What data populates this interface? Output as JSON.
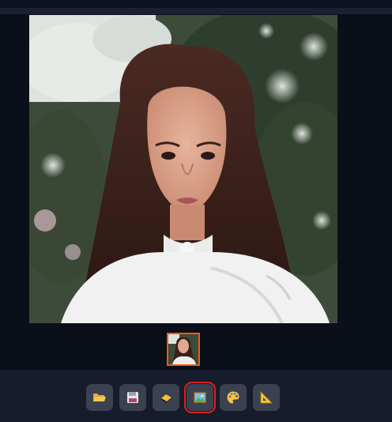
{
  "viewer": {
    "image_name": "portrait-photo"
  },
  "thumbnails": {
    "items": [
      {
        "name": "portrait-thumbnail",
        "selected": true
      }
    ],
    "accent": "#f05a16"
  },
  "toolbar": {
    "tools": [
      {
        "icon": "open-folder-icon"
      },
      {
        "icon": "save-floppy-icon"
      },
      {
        "icon": "eraser-icon"
      },
      {
        "icon": "image-icon",
        "selected": true
      },
      {
        "icon": "palette-icon"
      },
      {
        "icon": "set-square-ruler-icon"
      }
    ],
    "selected_outline": "#e01e1e"
  }
}
